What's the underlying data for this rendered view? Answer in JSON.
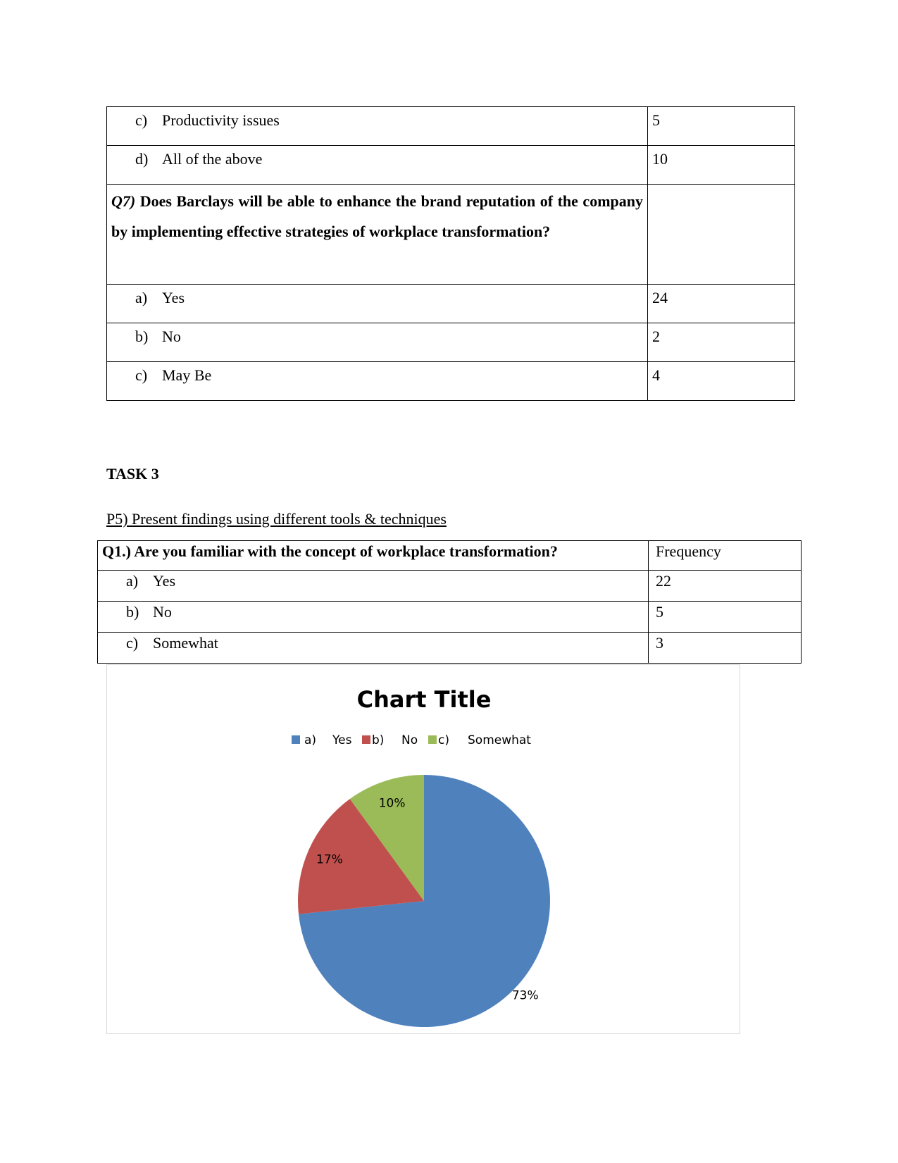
{
  "table1": {
    "rows": [
      {
        "letter": "c)",
        "label": "Productivity issues",
        "value": "5"
      },
      {
        "letter": "d)",
        "label": "All of the above",
        "value": "10"
      }
    ],
    "question": {
      "prefix": "Q7)",
      "text": " Does Barclays will be able to enhance the brand reputation of the company by implementing effective strategies of workplace transformation?"
    },
    "answers": [
      {
        "letter": "a)",
        "label": "Yes",
        "value": "24"
      },
      {
        "letter": "b)",
        "label": "No",
        "value": "2"
      },
      {
        "letter": "c)",
        "label": "May Be",
        "value": "4"
      }
    ]
  },
  "task_heading": "TASK 3",
  "subheading": "P5) Present findings using different tools & techniques",
  "table2": {
    "question": "Q1.) Are you familiar with the concept of workplace transformation?",
    "header": "Frequency",
    "rows": [
      {
        "letter": "a)",
        "label": "Yes",
        "value": "22"
      },
      {
        "letter": "b)",
        "label": "No",
        "value": "5"
      },
      {
        "letter": "c)",
        "label": "Somewhat",
        "value": "3"
      }
    ]
  },
  "chart_data": {
    "type": "pie",
    "title": "Chart Title",
    "legend_position": "top",
    "categories": [
      "a)      Yes",
      "b)      No",
      "c)      Somewhat"
    ],
    "legend": [
      {
        "key": "a)",
        "label": "Yes"
      },
      {
        "key": "b)",
        "label": "No"
      },
      {
        "key": "c)",
        "label": "Somewhat"
      }
    ],
    "values": [
      22,
      5,
      3
    ],
    "labels": [
      "73%",
      "17%",
      "10%"
    ],
    "colors": [
      "#4f81bd",
      "#c0504d",
      "#9bbb59"
    ]
  }
}
